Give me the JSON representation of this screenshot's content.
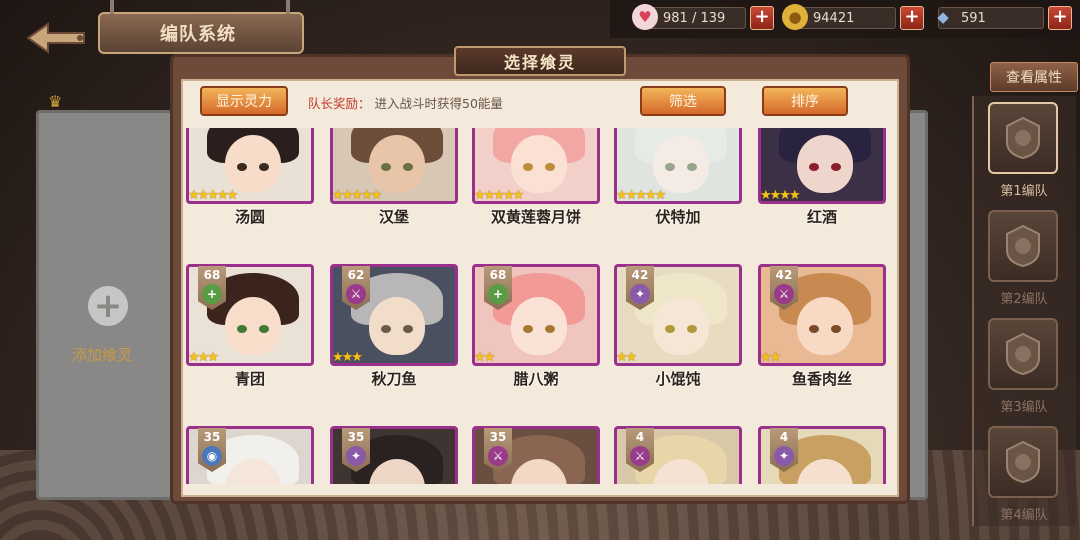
{
  "header": {
    "title": "编队系统",
    "back": "back-arrow"
  },
  "resources": [
    {
      "icon": "heart-icon",
      "value": "981 / 139",
      "color": "#d9405a"
    },
    {
      "icon": "coin-icon",
      "value": "94421",
      "color": "#e0b13a"
    },
    {
      "icon": "crystal-icon",
      "value": "591",
      "color": "#8fb6e0"
    }
  ],
  "view_attr": "查看属性",
  "teams": [
    "第1编队",
    "第2编队",
    "第3编队",
    "第4编队"
  ],
  "add_panel": {
    "label": "添加飨灵"
  },
  "modal": {
    "title": "选择飨灵",
    "show_power": "显示灵力",
    "bonus_label": "队长奖励：",
    "bonus_text": "进入战斗时获得50能量",
    "filter": "筛选",
    "sort": "排序"
  },
  "cards": [
    {
      "name": "汤圆",
      "stars": "★★★★★",
      "level": "",
      "hair": "#2a1f1d",
      "skin": "#f7dcc9",
      "bg": "#e9e1d5",
      "eye": "#3a2a20"
    },
    {
      "name": "汉堡",
      "stars": "★★★★★",
      "level": "",
      "hair": "#6b4d39",
      "skin": "#e8c4a8",
      "bg": "#d9c7b5",
      "eye": "#6a7040"
    },
    {
      "name": "双黄莲蓉月饼",
      "stars": "★★★★★",
      "level": "",
      "hair": "#f2a7a4",
      "skin": "#fbe1d4",
      "bg": "#f3cfc9",
      "eye": "#b98f3a"
    },
    {
      "name": "伏特加",
      "stars": "★★★★★",
      "level": "",
      "hair": "#e7ebe6",
      "skin": "#f4ece4",
      "bg": "#dfe4df",
      "eye": "#9aa48c"
    },
    {
      "name": "红酒",
      "stars": "★★★★",
      "level": "",
      "hair": "#2a2340",
      "skin": "#efd6cc",
      "bg": "#3b3046",
      "eye": "#8a1f2a"
    },
    {
      "name": "青团",
      "stars": "★★★",
      "level": "68",
      "element": "+",
      "el_color": "#5a9c45",
      "hair": "#3a241c",
      "skin": "#f8ddcb",
      "bg": "#eae2d6",
      "eye": "#3e7a34"
    },
    {
      "name": "秋刀鱼",
      "stars": "★★★",
      "level": "62",
      "element": "⚔",
      "el_color": "#9a3a8a",
      "hair": "#b8b6b6",
      "skin": "#f2dcca",
      "bg": "#4a5060",
      "eye": "#6a5a4a"
    },
    {
      "name": "腊八粥",
      "stars": "★★",
      "level": "68",
      "element": "+",
      "el_color": "#5a9c45",
      "hair": "#f19a96",
      "skin": "#fbe2d6",
      "bg": "#f0c5c0",
      "eye": "#a77a34"
    },
    {
      "name": "小馄饨",
      "stars": "★★",
      "level": "42",
      "element": "✦",
      "el_color": "#8a5aa8",
      "hair": "#efe6c9",
      "skin": "#f5e6d6",
      "bg": "#e7dcc1",
      "eye": "#b0993a"
    },
    {
      "name": "鱼香肉丝",
      "stars": "★★",
      "level": "42",
      "element": "⚔",
      "el_color": "#9a3a8a",
      "hair": "#c98a52",
      "skin": "#f7d9c4",
      "bg": "#e9b993",
      "eye": "#7a4a2a"
    },
    {
      "name": "",
      "stars": "",
      "level": "35",
      "element": "◉",
      "el_color": "#4a78b8",
      "hair": "#f2f0ec",
      "skin": "#f6e6da",
      "bg": "#dcd6cf",
      "eye": "#8a7a6a"
    },
    {
      "name": "",
      "stars": "",
      "level": "35",
      "element": "✦",
      "el_color": "#8a5aa8",
      "hair": "#2a2220",
      "skin": "#eed6c6",
      "bg": "#3e3432",
      "eye": "#6a4a3a"
    },
    {
      "name": "",
      "stars": "",
      "level": "35",
      "element": "⚔",
      "el_color": "#9a3a8a",
      "hair": "#8a6652",
      "skin": "#f2d9c6",
      "bg": "#6a4e40",
      "eye": "#6a4a3a"
    },
    {
      "name": "",
      "stars": "",
      "level": "4",
      "element": "⚔",
      "el_color": "#9a3a8a",
      "hair": "#e8d6a8",
      "skin": "#f5e2d2",
      "bg": "#d8c8a8",
      "eye": "#8a7a4a"
    },
    {
      "name": "",
      "stars": "",
      "level": "4",
      "element": "✦",
      "el_color": "#8a5aa8",
      "hair": "#c8a062",
      "skin": "#f4e0cc",
      "bg": "#e6d9b8",
      "eye": "#8a6a3a"
    }
  ]
}
